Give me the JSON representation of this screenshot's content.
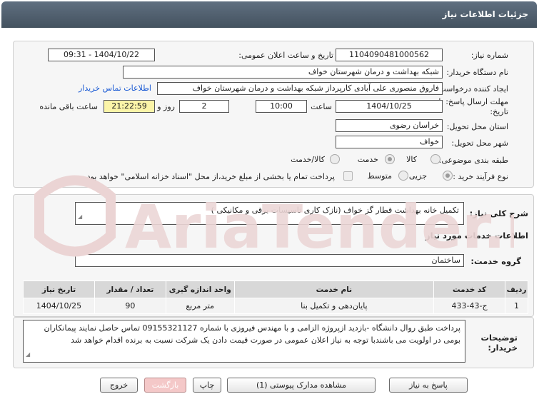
{
  "page": {
    "title": "جزئیات اطلاعات نیاز"
  },
  "info": {
    "need_number_label": "شماره نیاز:",
    "need_number": "1104090481000562",
    "announce_label": "تاریخ و ساعت اعلان عمومی:",
    "announce_value": "1404/10/22 - 09:31",
    "buyer_org_label": "نام دستگاه خریدار:",
    "buyer_org": "شبکه بهداشت و درمان شهرستان خواف",
    "creator_label": "ایجاد کننده درخواست:",
    "creator": "فاروق منصوری علی آبادی کارپرداز شبکه بهداشت و درمان شهرستان خواف",
    "contact_link": "اطلاعات تماس خریدار",
    "deadline_label_1": "مهلت ارسال پاسخ: تا",
    "deadline_label_2": "تاریخ:",
    "deadline_date": "1404/10/25",
    "time_label": "ساعت",
    "deadline_time": "10:00",
    "days": "2",
    "days_label": "روز و",
    "remaining_time": "21:22:59",
    "remaining_label": "ساعت باقی مانده",
    "province_label": "استان محل تحویل:",
    "province": "خراسان رضوی",
    "city_label": "شهر محل تحویل:",
    "city": "خواف",
    "category_label": "طبقه بندی موضوعی:",
    "category_options": [
      "کالا",
      "خدمت",
      "کالا/خدمت"
    ],
    "category_selected": "خدمت",
    "process_label": "نوع فرآیند خرید :",
    "process_options": [
      "جزیی",
      "متوسط"
    ],
    "process_selected": "جزیی",
    "payment_note": "پرداخت تمام یا بخشی از مبلغ خرید،از محل \"اسناد خزانه اسلامی\" خواهد بود."
  },
  "description": {
    "label": "شرح کلی نیاز:",
    "value": "تکمیل خانه بهداشت قطار گز خواف (نازک کاری  تاسیسات برقی و مکانیکی )"
  },
  "services": {
    "section_title": "اطلاعات خدمات مورد نیاز",
    "group_label": "گروه خدمت:",
    "group_value": "ساختمان",
    "columns": [
      "ردیف",
      "کد خدمت",
      "نام خدمت",
      "واحد اندازه گیری",
      "تعداد / مقدار",
      "تاریخ نیاز"
    ],
    "rows": [
      [
        "1",
        "ج-43-433",
        "پایان‌دهی و تکمیل بنا",
        "متر مربع",
        "90",
        "1404/10/25"
      ]
    ]
  },
  "notes": {
    "label_1": "توضیحات",
    "label_2": "خریدار:",
    "value": "پرداخت طبق روال دانشگاه -بازدید ازپروژه الزامی و با مهندس فیروزی با شماره 09155321127 تماس حاصل نمایند پیمانکاران بومی در اولویت می باشندبا توجه به نیاز اعلان عمومی در صورت قیمت دادن یک شرکت نسبت به برنده اقدام خواهد شد"
  },
  "buttons": {
    "reply": "پاسخ به نیاز",
    "docs": "مشاهده مدارک پیوستی (1)",
    "print": "چاپ",
    "back": "بازگشت",
    "exit": "خروج"
  },
  "watermark": {
    "brand": "AriaTender.net"
  },
  "colors": {
    "header": "#4f5d6b",
    "link": "#1a5ad4",
    "remaining_bg": "#fbf4a8",
    "watermark": "#e9d3d3"
  }
}
